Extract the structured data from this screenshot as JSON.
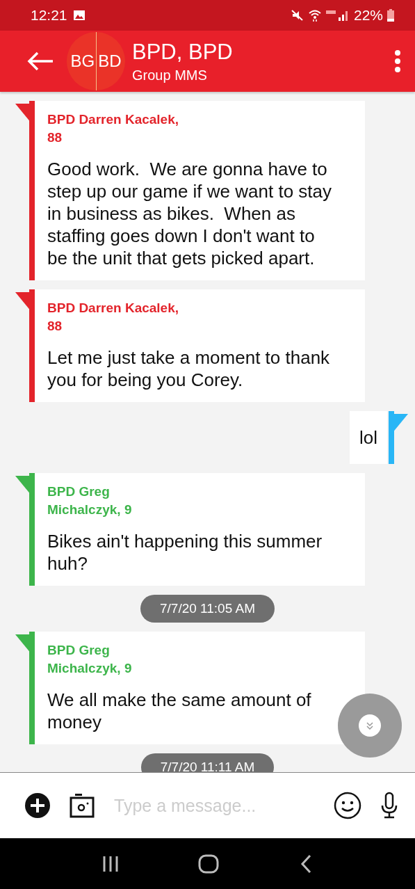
{
  "status_bar": {
    "time": "12:21",
    "battery": "22%"
  },
  "header": {
    "avatar_initials": [
      "BG",
      "BD"
    ],
    "title": "BPD, BPD",
    "subtitle": "Group MMS"
  },
  "messages": [
    {
      "kind": "incoming",
      "sender": "BPD Darren Kacalek,\n88",
      "color": "#e3242b",
      "text": "Good work.  We are gonna have to step up our game if we want to stay in business as bikes.  When as staffing goes down I don't want to be the unit that gets picked apart."
    },
    {
      "kind": "incoming",
      "sender": "BPD Darren Kacalek,\n88",
      "color": "#e3242b",
      "text": "Let me just take a moment to thank you for being you Corey."
    },
    {
      "kind": "outgoing",
      "color": "#29b6f6",
      "text": "lol"
    },
    {
      "kind": "incoming",
      "sender": "BPD Greg\nMichalczyk, 9",
      "color": "#3db54b",
      "text": "Bikes ain't happening this summer huh?"
    },
    {
      "kind": "timestamp",
      "text": "7/7/20 11:05 AM"
    },
    {
      "kind": "incoming",
      "sender": "BPD Greg\nMichalczyk, 9",
      "color": "#3db54b",
      "text": "We all make the same amount of money"
    },
    {
      "kind": "timestamp",
      "text": "7/7/20 11:11 AM"
    }
  ],
  "composer": {
    "placeholder": "Type a message..."
  }
}
